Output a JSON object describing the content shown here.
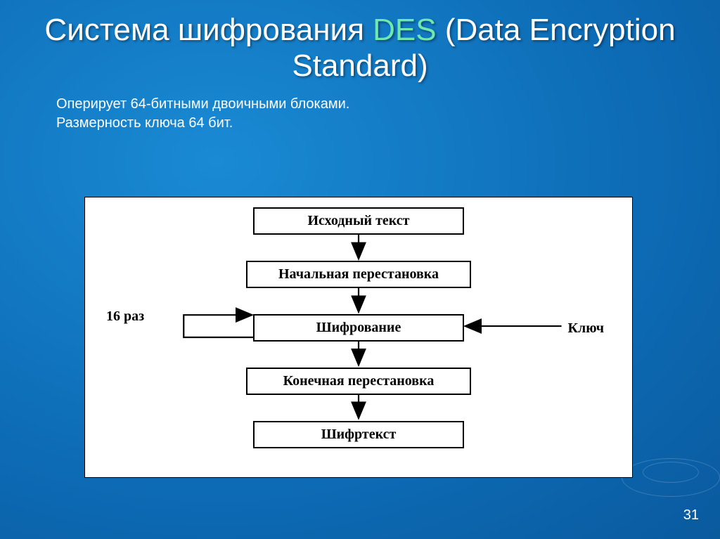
{
  "title": {
    "part1": "Система шифрования ",
    "accent": "DES",
    "part2": " (Data Encryption Standard)"
  },
  "subtext": {
    "line1": "Оперирует 64-битными двоичными блоками.",
    "line2": "Размерность ключа 64 бит."
  },
  "diagram": {
    "boxes": [
      "Исходный текст",
      "Начальная перестановка",
      "Шифрование",
      "Конечная перестановка",
      "Шифртекст"
    ],
    "left_label": "16 раз",
    "right_label": "Ключ"
  },
  "page_number": "31",
  "chart_data": {
    "type": "flowchart",
    "title": "Система шифрования DES (Data Encryption Standard)",
    "nodes": [
      {
        "id": "n0",
        "label": "Исходный текст"
      },
      {
        "id": "n1",
        "label": "Начальная перестановка"
      },
      {
        "id": "n2",
        "label": "Шифрование"
      },
      {
        "id": "n3",
        "label": "Конечная перестановка"
      },
      {
        "id": "n4",
        "label": "Шифртекст"
      }
    ],
    "edges": [
      {
        "from": "n0",
        "to": "n1"
      },
      {
        "from": "n1",
        "to": "n2"
      },
      {
        "from": "n2",
        "to": "n3"
      },
      {
        "from": "n3",
        "to": "n4"
      },
      {
        "from": "n2",
        "to": "n2",
        "label": "16 раз",
        "type": "loop"
      },
      {
        "from": "key",
        "to": "n2",
        "label": "Ключ",
        "type": "external-input"
      }
    ]
  }
}
